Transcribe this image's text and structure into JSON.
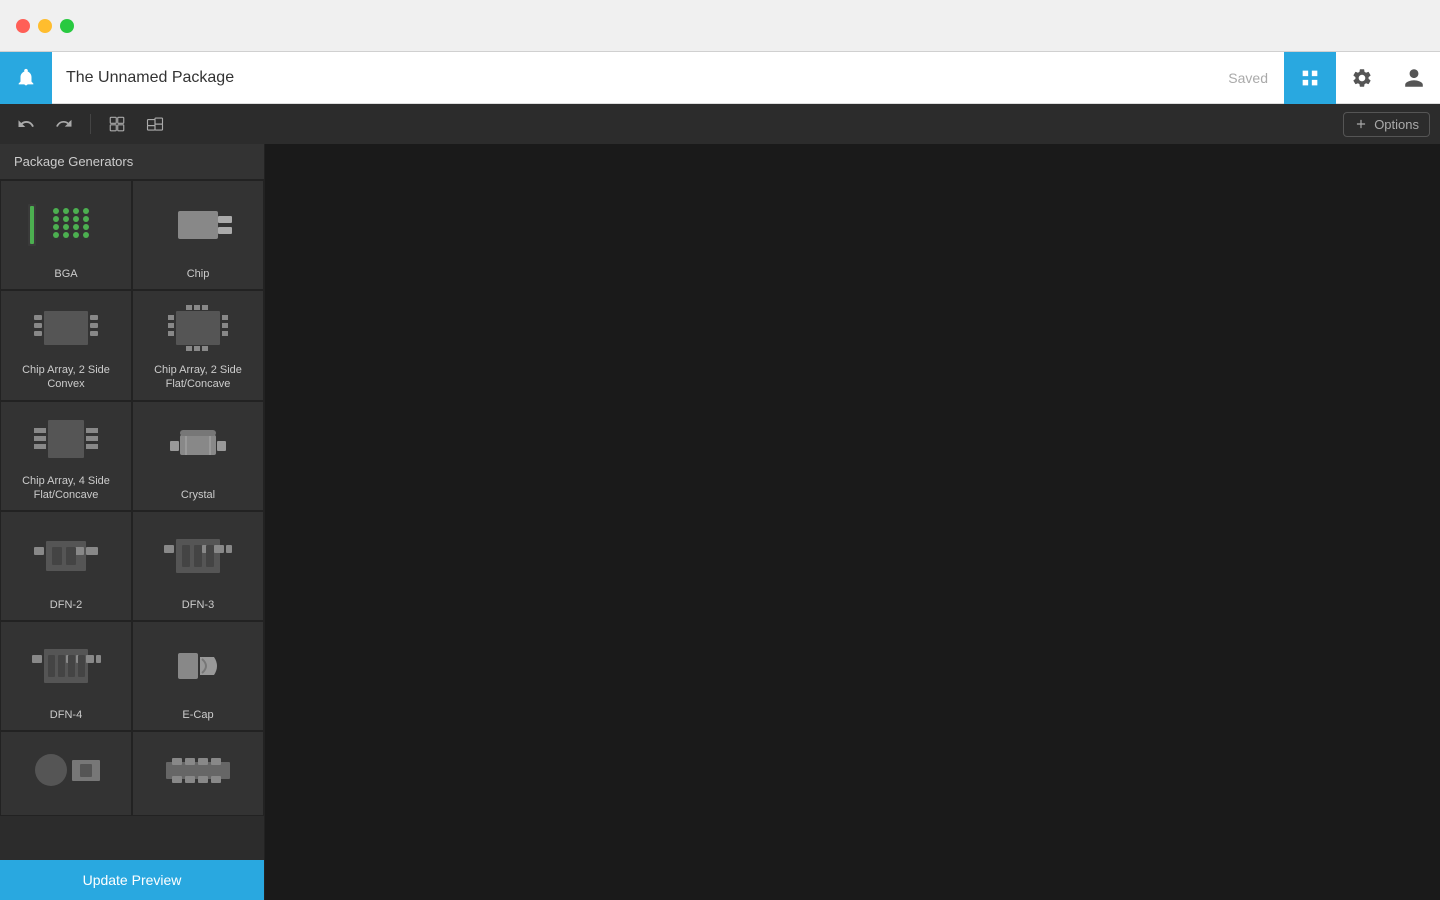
{
  "titlebar": {
    "traffic": [
      "red",
      "yellow",
      "green"
    ]
  },
  "appbar": {
    "title": "The Unnamed Package",
    "saved_label": "Saved",
    "logo_icon": "bell-icon",
    "settings_icon": "gear-icon",
    "user_icon": "user-icon",
    "view_icon": "package-view-icon"
  },
  "toolbar": {
    "undo_label": "Undo",
    "redo_label": "Redo",
    "view2d_label": "2D View",
    "view3d_label": "3D View",
    "options_label": "Options"
  },
  "sidebar": {
    "header": "Package Generators",
    "update_preview": "Update Preview",
    "items": [
      {
        "id": "bga",
        "label": "BGA"
      },
      {
        "id": "chip",
        "label": "Chip"
      },
      {
        "id": "chip-array-2-convex",
        "label": "Chip Array, 2 Side Convex"
      },
      {
        "id": "chip-array-2-flat",
        "label": "Chip Array, 2 Side Flat/Concave"
      },
      {
        "id": "chip-array-4-flat",
        "label": "Chip Array, 4 Side Flat/Concave"
      },
      {
        "id": "crystal",
        "label": "Crystal"
      },
      {
        "id": "dfn-2",
        "label": "DFN-2"
      },
      {
        "id": "dfn-3",
        "label": "DFN-3"
      },
      {
        "id": "dfn-4",
        "label": "DFN-4"
      },
      {
        "id": "e-cap",
        "label": "E-Cap"
      },
      {
        "id": "last1",
        "label": ""
      },
      {
        "id": "last2",
        "label": ""
      }
    ]
  }
}
